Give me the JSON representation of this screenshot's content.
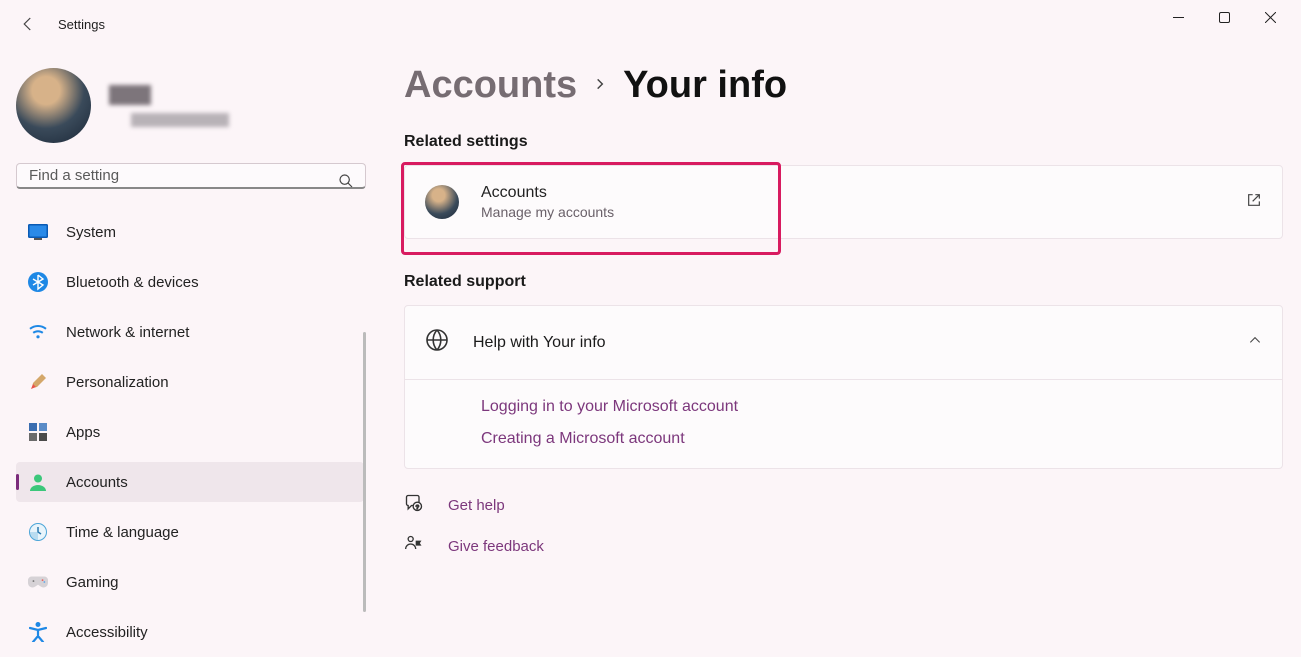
{
  "window": {
    "title": "Settings"
  },
  "search": {
    "placeholder": "Find a setting"
  },
  "nav": {
    "items": [
      {
        "id": "system",
        "label": "System"
      },
      {
        "id": "bluetooth",
        "label": "Bluetooth & devices"
      },
      {
        "id": "network",
        "label": "Network & internet"
      },
      {
        "id": "personalization",
        "label": "Personalization"
      },
      {
        "id": "apps",
        "label": "Apps"
      },
      {
        "id": "accounts",
        "label": "Accounts"
      },
      {
        "id": "time",
        "label": "Time & language"
      },
      {
        "id": "gaming",
        "label": "Gaming"
      },
      {
        "id": "accessibility",
        "label": "Accessibility"
      }
    ]
  },
  "breadcrumb": {
    "parent": "Accounts",
    "current": "Your info"
  },
  "sections": {
    "related_settings": {
      "title": "Related settings",
      "card": {
        "title": "Accounts",
        "subtitle": "Manage my accounts"
      }
    },
    "related_support": {
      "title": "Related support",
      "help": {
        "title": "Help with Your info",
        "links": [
          "Logging in to your Microsoft account",
          "Creating a Microsoft account"
        ]
      }
    }
  },
  "footer": {
    "get_help": "Get help",
    "feedback": "Give feedback"
  },
  "colors": {
    "accent": "#7c377c",
    "highlight": "#d81b60"
  }
}
